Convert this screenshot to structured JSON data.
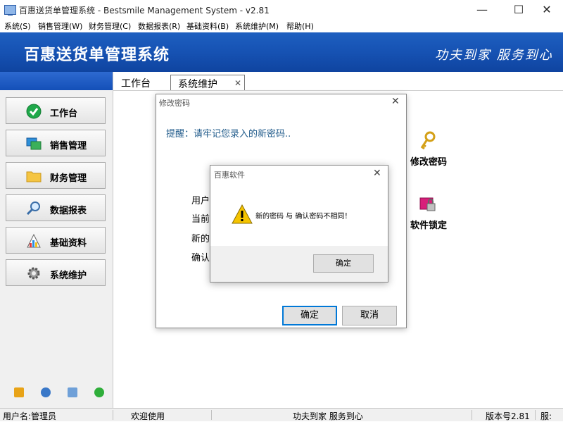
{
  "window": {
    "title": "百惠送货单管理系统 - Bestsmile Management System - v2.81",
    "minimize": "—",
    "maximize": "☐",
    "close": "✕"
  },
  "menu": [
    "系统(S)",
    "销售管理(W)",
    "财务管理(C)",
    "数据报表(R)",
    "基础资料(B)",
    "系统维护(M)",
    "帮助(H)"
  ],
  "banner": {
    "title": "百惠送货单管理系统",
    "slogan": "功夫到家  服务到心"
  },
  "sidebar": {
    "items": [
      {
        "label": "工作台",
        "icon": "check-icon"
      },
      {
        "label": "销售管理",
        "icon": "windows-icon"
      },
      {
        "label": "财务管理",
        "icon": "folder-icon"
      },
      {
        "label": "数据报表",
        "icon": "magnifier-icon"
      },
      {
        "label": "基础资料",
        "icon": "palette-icon"
      },
      {
        "label": "系统维护",
        "icon": "gear-icon"
      }
    ],
    "tools": [
      "key-icon",
      "clock-icon",
      "monitor-icon",
      "back-arrow-icon"
    ]
  },
  "tabs": {
    "workbench": "工作台",
    "system": "系统维护",
    "close": "✕"
  },
  "functions": {
    "change_password": "修改密码",
    "lock": "软件锁定"
  },
  "pwd_dialog": {
    "title": "修改密码",
    "close": "✕",
    "reminder": "提醒：请牢记您录入的新密码..",
    "fields": [
      "用户",
      "当前",
      "新的",
      "确认"
    ],
    "ok": "确定",
    "cancel": "取消"
  },
  "msgbox": {
    "title": "百惠软件",
    "close": "✕",
    "message": "新的密码 与 确认密码不相同！",
    "ok": "确定"
  },
  "status": {
    "user": "用户名:管理员",
    "welcome": "欢迎使用",
    "motto": "功夫到家 服务到心",
    "version": "版本号2.81",
    "extra": "服:"
  },
  "colors": {
    "banner": "#1652b3",
    "accent_blue": "#0078d7",
    "warning": "#f5c400"
  }
}
